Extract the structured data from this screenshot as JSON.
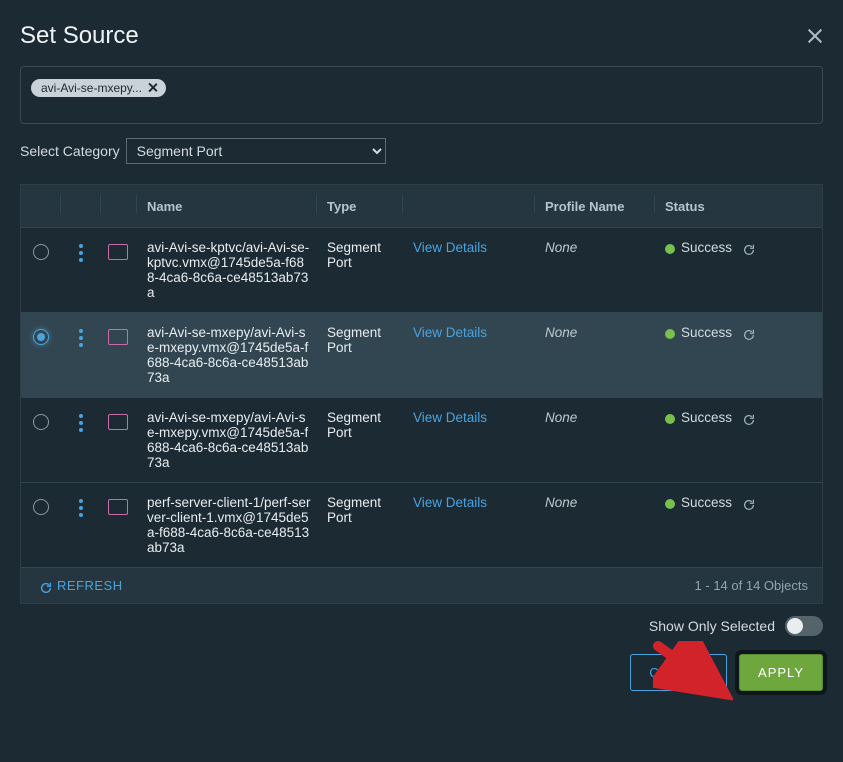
{
  "title": "Set Source",
  "chip": {
    "label": "avi-Avi-se-mxepy..."
  },
  "category": {
    "label": "Select Category",
    "selected": "Segment Port",
    "options": [
      "Segment Port"
    ]
  },
  "columns": {
    "name": "Name",
    "type": "Type",
    "profile": "Profile Name",
    "status": "Status"
  },
  "rows": [
    {
      "selected": false,
      "name": "avi-Avi-se-kptvc/avi-Avi-se-kptvc.vmx@1745de5a-f688-4ca6-8c6a-ce48513ab73a",
      "type": "Segment Port",
      "view": "View Details",
      "profile": "None",
      "status": "Success"
    },
    {
      "selected": true,
      "name": "avi-Avi-se-mxepy/avi-Avi-se-mxepy.vmx@1745de5a-f688-4ca6-8c6a-ce48513ab73a",
      "type": "Segment Port",
      "view": "View Details",
      "profile": "None",
      "status": "Success"
    },
    {
      "selected": false,
      "name": "avi-Avi-se-mxepy/avi-Avi-se-mxepy.vmx@1745de5a-f688-4ca6-8c6a-ce48513ab73a",
      "type": "Segment Port",
      "view": "View Details",
      "profile": "None",
      "status": "Success"
    },
    {
      "selected": false,
      "name": "perf-server-client-1/perf-server-client-1.vmx@1745de5a-f688-4ca6-8c6a-ce48513ab73a",
      "type": "Segment Port",
      "view": "View Details",
      "profile": "None",
      "status": "Success"
    }
  ],
  "footer": {
    "refresh": "REFRESH",
    "count": "1 - 14 of 14 Objects"
  },
  "show_only": "Show Only Selected",
  "buttons": {
    "cancel": "CANCEL",
    "apply": "APPLY"
  }
}
